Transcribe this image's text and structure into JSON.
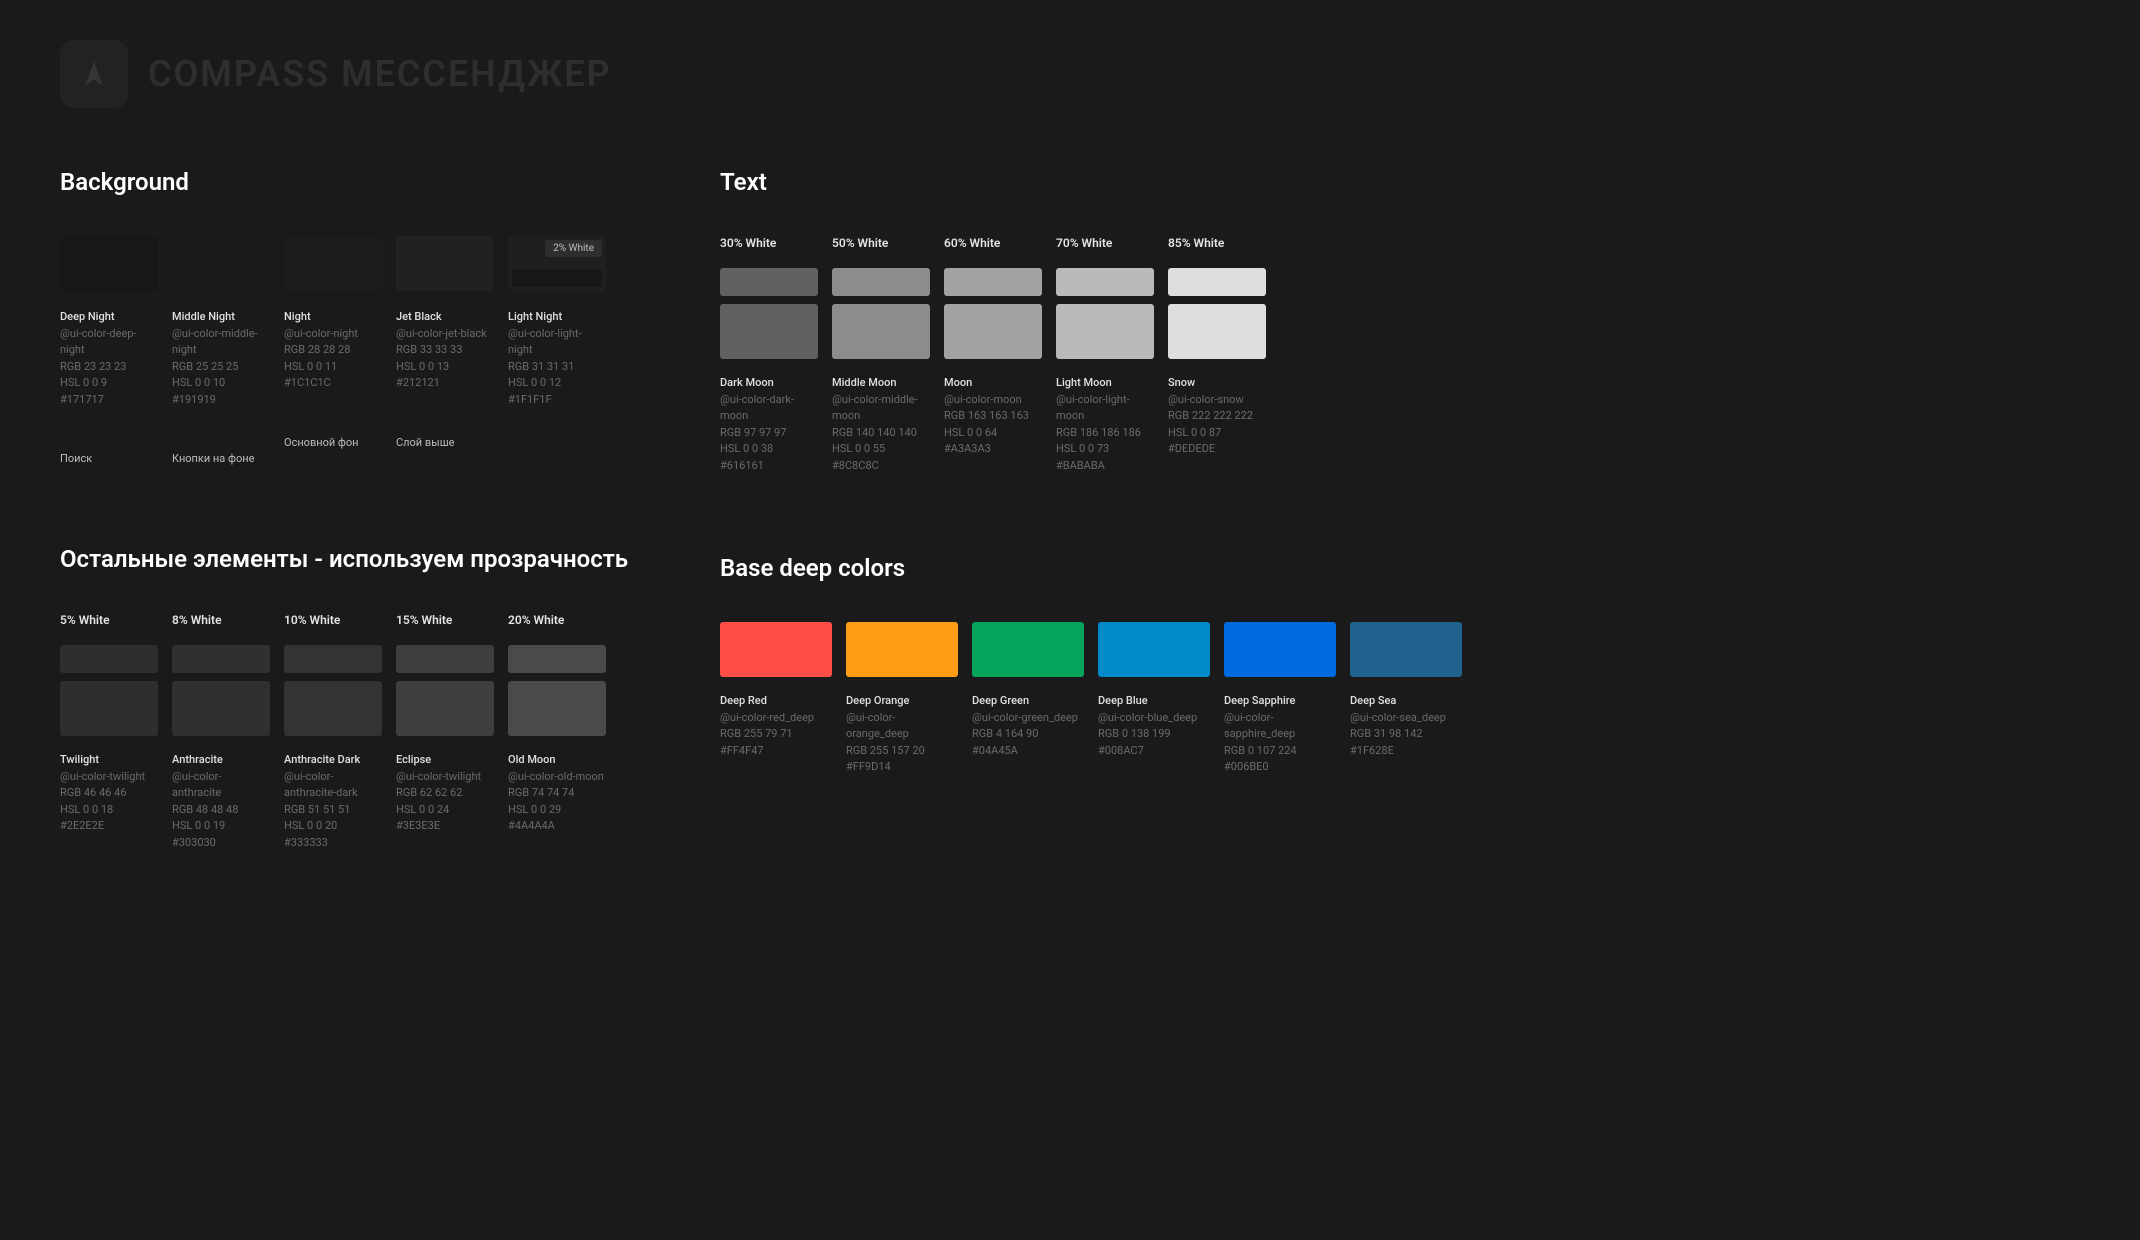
{
  "brand": {
    "title": "COMPASS МЕССЕНДЖЕР"
  },
  "sections": {
    "background_title": "Background",
    "text_title": "Text",
    "other_title": "Остальные элементы - используем прозрачность",
    "deep_title": "Base deep colors"
  },
  "background": [
    {
      "name": "Deep Night",
      "token": "@ui-color-deep-night",
      "rgb": "RGB 23 23 23",
      "hsl": "HSL 0 0 9",
      "hex": "#171717",
      "note": "Поиск"
    },
    {
      "name": "Middle Night",
      "token": "@ui-color-middle-night",
      "rgb": "RGB 25 25 25",
      "hsl": "HSL 0 0 10",
      "hex": "#191919",
      "note": "Кнопки на фоне"
    },
    {
      "name": "Night",
      "token": "@ui-color-night",
      "rgb": "RGB 28 28 28",
      "hsl": "HSL 0 0 11",
      "hex": "#1C1C1C",
      "note": "Основной фон"
    },
    {
      "name": "Jet Black",
      "token": "@ui-color-jet-black",
      "rgb": "RGB 33 33 33",
      "hsl": "HSL 0 0 13",
      "hex": "#212121",
      "note": "Слой выше"
    },
    {
      "name": "Light Night",
      "token": "@ui-color-light-night",
      "rgb": "RGB 31 31 31",
      "hsl": "HSL 0 0 12",
      "hex": "#1F1F1F",
      "badge": "2% White",
      "inner": "#171717"
    }
  ],
  "text": [
    {
      "label": "30% White",
      "name": "Dark Moon",
      "token": "@ui-color-dark-moon",
      "rgb": "RGB 97 97 97",
      "hsl": "HSL 0 0 38",
      "hex": "#616161"
    },
    {
      "label": "50% White",
      "name": "Middle Moon",
      "token": "@ui-color-middle-moon",
      "rgb": "RGB 140 140 140",
      "hsl": "HSL 0 0 55",
      "hex": "#8C8C8C"
    },
    {
      "label": "60% White",
      "name": "Moon",
      "token": "@ui-color-moon",
      "rgb": "RGB 163 163 163",
      "hsl": "HSL 0 0 64",
      "hex": "#A3A3A3"
    },
    {
      "label": "70% White",
      "name": "Light Moon",
      "token": "@ui-color-light-moon",
      "rgb": "RGB 186 186 186",
      "hsl": "HSL 0 0 73",
      "hex": "#BABABA"
    },
    {
      "label": "85% White",
      "name": "Snow",
      "token": "@ui-color-snow",
      "rgb": "RGB 222 222 222",
      "hsl": "HSL 0 0 87",
      "hex": "#DEDEDE"
    }
  ],
  "other": [
    {
      "label": "5% White",
      "name": "Twilight",
      "token": "@ui-color-twilight",
      "rgb": "RGB 46 46 46",
      "hsl": "HSL 0 0 18",
      "hex": "#2E2E2E"
    },
    {
      "label": "8% White",
      "name": "Anthracite",
      "token": "@ui-color-anthracite",
      "rgb": "RGB 48 48 48",
      "hsl": "HSL 0 0 19",
      "hex": "#303030"
    },
    {
      "label": "10% White",
      "name": "Anthracite Dark",
      "token": "@ui-color-anthracite-dark",
      "rgb": "RGB 51 51 51",
      "hsl": "HSL 0 0 20",
      "hex": "#333333"
    },
    {
      "label": "15% White",
      "name": "Eclipse",
      "token": "@ui-color-twilight",
      "rgb": "RGB 62 62 62",
      "hsl": "HSL 0 0 24",
      "hex": "#3E3E3E"
    },
    {
      "label": "20% White",
      "name": "Old Moon",
      "token": "@ui-color-old-moon",
      "rgb": "RGB 74 74 74",
      "hsl": "HSL 0 0 29",
      "hex": "#4A4A4A"
    }
  ],
  "deep": [
    {
      "name": "Deep Red",
      "token": "@ui-color-red_deep",
      "rgb": "RGB 255 79 71",
      "hex": "#FF4F47"
    },
    {
      "name": "Deep Orange",
      "token": "@ui-color-orange_deep",
      "rgb": "RGB 255 157 20",
      "hex": "#FF9D14"
    },
    {
      "name": "Deep Green",
      "token": "@ui-color-green_deep",
      "rgb": "RGB 4 164 90",
      "hex": "#04A45A"
    },
    {
      "name": "Deep Blue",
      "token": "@ui-color-blue_deep",
      "rgb": "RGB 0 138 199",
      "hex": "#008AC7"
    },
    {
      "name": "Deep Sapphire",
      "token": "@ui-color-sapphire_deep",
      "rgb": "RGB 0 107 224",
      "hex": "#006BE0"
    },
    {
      "name": "Deep Sea",
      "token": "@ui-color-sea_deep",
      "rgb": "RGB 31 98 142",
      "hex": "#1F628E"
    }
  ]
}
